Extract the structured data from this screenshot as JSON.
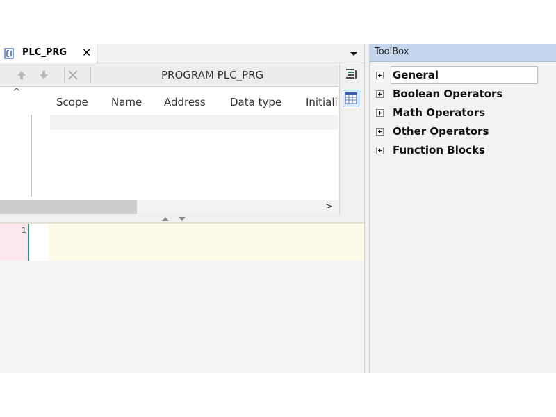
{
  "editor": {
    "tab": {
      "label": "PLC_PRG",
      "close_symbol": "✕"
    },
    "toolbar": {
      "title": "PROGRAM PLC_PRG",
      "buttons": [
        "move-up-icon",
        "move-down-icon",
        "delete-icon"
      ]
    },
    "table": {
      "columns": [
        "Scope",
        "Name",
        "Address",
        "Data type",
        "Initiali"
      ],
      "collapse_symbol": "^"
    },
    "implementation": {
      "line_number": "1"
    }
  },
  "toolbox": {
    "title": "ToolBox",
    "items": [
      {
        "label": "General"
      },
      {
        "label": "Boolean Operators"
      },
      {
        "label": "Math Operators"
      },
      {
        "label": "Other Operators"
      },
      {
        "label": "Function Blocks"
      }
    ]
  },
  "colors": {
    "toolbox_header": "#c4d6ee",
    "implementation_bg": "#fdfbe8",
    "gutter_bg": "#fbe7ec",
    "accent_border": "#2a8f8f"
  }
}
